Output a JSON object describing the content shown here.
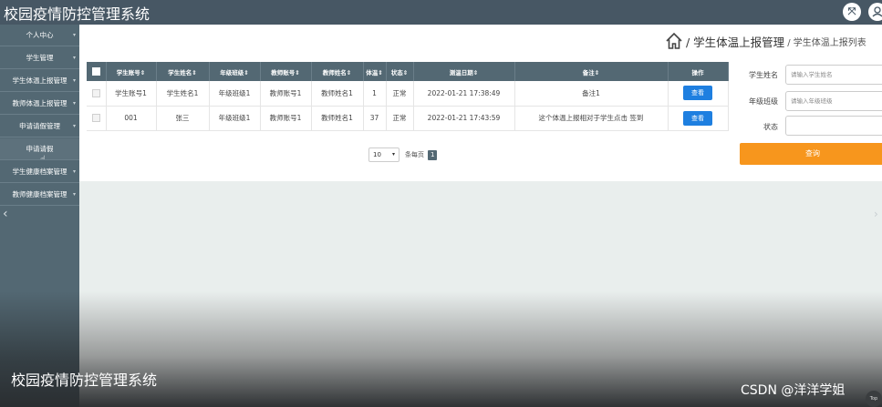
{
  "header": {
    "app_title": "校园疫情防控管理系统",
    "fullscreen_icon": "fullscreen-icon",
    "user_icon": "user-icon"
  },
  "sidebar": {
    "items": [
      {
        "label": "个人中心"
      },
      {
        "label": "学生管理"
      },
      {
        "label": "学生体温上报管理"
      },
      {
        "label": "教师体温上报管理"
      },
      {
        "label": "申请请假管理"
      },
      {
        "label": "申请请假"
      },
      {
        "label": "学生健康档案管理"
      },
      {
        "label": "教师健康档案管理"
      }
    ],
    "active_index": 5
  },
  "breadcrumb": {
    "main": "/ 学生体温上报管理",
    "sub": "/ 学生体温上报列表"
  },
  "table": {
    "headers": [
      "学生账号⇕",
      "学生姓名⇕",
      "年级班级⇕",
      "教师账号⇕",
      "教师姓名⇕",
      "体温⇕",
      "状态⇕",
      "测温日期⇕",
      "备注⇕",
      "操作"
    ],
    "rows": [
      [
        "学生账号1",
        "学生姓名1",
        "年级班级1",
        "教师账号1",
        "教师姓名1",
        "1",
        "正常",
        "2022-01-21 17:38:49",
        "备注1",
        "查看"
      ],
      [
        "001",
        "张三",
        "年级班级1",
        "教师账号1",
        "教师姓名1",
        "37",
        "正常",
        "2022-01-21 17:43:59",
        "这个体温上报相对于学生点击 签到",
        "查看"
      ]
    ]
  },
  "pager": {
    "page_size": "10",
    "per_page_label": "条每页",
    "current_page": "1"
  },
  "search": {
    "student_name_label": "学生姓名",
    "student_name_placeholder": "请输入学生姓名",
    "class_label": "年级班级",
    "class_placeholder": "请输入年级班级",
    "status_label": "状态",
    "status_value": "",
    "query_button": "查询"
  },
  "footer": {
    "title": "校园疫情防控管理系统",
    "watermark": "CSDN @洋洋学姐",
    "top_label": "Top"
  },
  "colors": {
    "header_bg": "#475764",
    "sidebar_bg": "#536873",
    "view_button": "#1e7fe0",
    "query_button": "#f7961d"
  }
}
